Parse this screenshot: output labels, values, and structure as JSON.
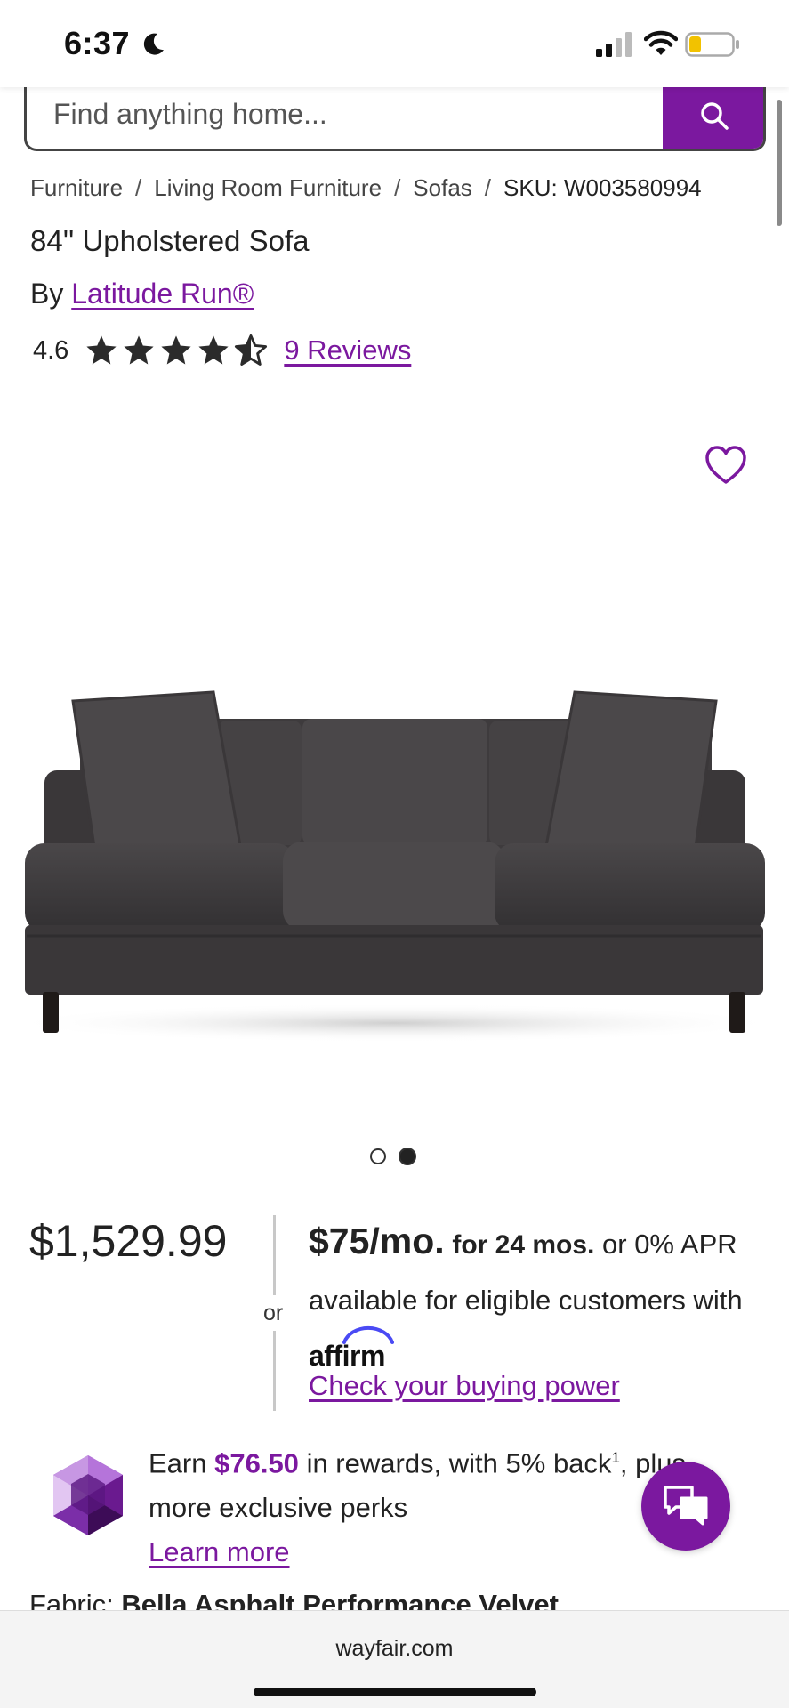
{
  "status_bar": {
    "time": "6:37"
  },
  "search": {
    "placeholder": "Find anything home..."
  },
  "breadcrumb": {
    "items": [
      "Furniture",
      "Living Room Furniture",
      "Sofas"
    ],
    "sku": "SKU: W003580994",
    "separator": "/"
  },
  "product": {
    "title": "84'' Upholstered Sofa",
    "by_prefix": "By",
    "brand": "Latitude Run®",
    "rating": "4.6",
    "rating_value": 4.6,
    "reviews_link": "9 Reviews",
    "image_count": 2,
    "active_image": 2
  },
  "pricing": {
    "price": "$1,529.99",
    "or_label": "or",
    "monthly": "$75/mo.",
    "term": "for 24 mos.",
    "financing_text_1": "or 0% APR available for eligible customers with",
    "affirm_logo": "affirm",
    "buying_power_link": "Check your buying power"
  },
  "rewards": {
    "earn_prefix": "Earn",
    "amount": "$76.50",
    "text_after_amount": "in rewards, with 5% back",
    "footnote": "1",
    "text_end": ", plus more exclusive perks",
    "learn_more": "Learn more"
  },
  "fabric": {
    "label": "Fabric:",
    "value": "Bella Asphalt Performance Velvet"
  },
  "browser": {
    "url": "wayfair.com"
  },
  "colors": {
    "brand_purple": "#7b189f"
  },
  "icons": [
    "moon-icon",
    "signal-icon",
    "wifi-icon",
    "battery-icon",
    "search-icon",
    "star-icon",
    "heart-icon",
    "gem-icon",
    "chat-icon"
  ]
}
